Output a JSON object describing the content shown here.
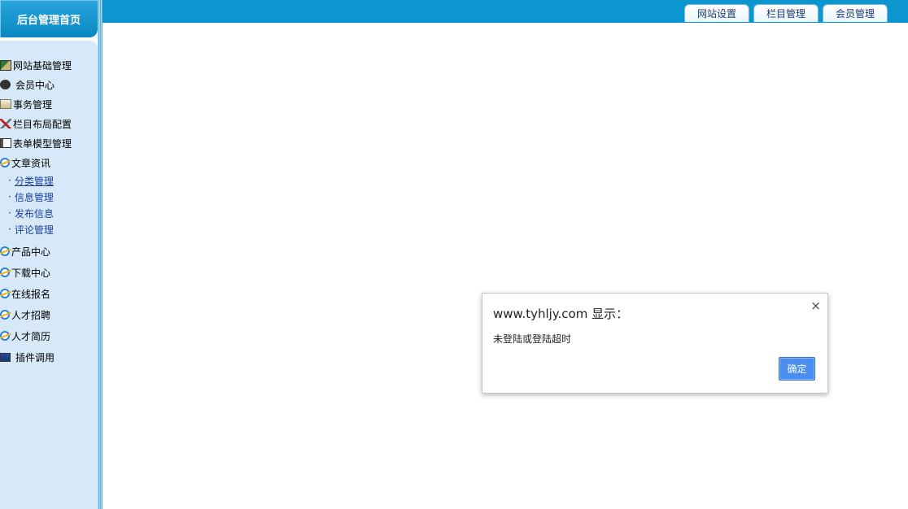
{
  "header": {
    "brand": "后台管理首页",
    "tabs": [
      {
        "label": "网站设置"
      },
      {
        "label": "栏目管理"
      },
      {
        "label": "会员管理"
      }
    ]
  },
  "sidebar": {
    "items": [
      {
        "label": "网站基础管理",
        "icon": "site-admin-icon"
      },
      {
        "label": "会员中心",
        "icon": "member-icon"
      },
      {
        "label": "事务管理",
        "icon": "affairs-icon"
      },
      {
        "label": "栏目布局配置",
        "icon": "tools-icon"
      },
      {
        "label": "表单模型管理",
        "icon": "form-icon"
      },
      {
        "label": "文章资讯",
        "icon": "ie-icon"
      }
    ],
    "subitems": [
      {
        "label": "分类管理"
      },
      {
        "label": "信息管理"
      },
      {
        "label": "发布信息"
      },
      {
        "label": "评论管理"
      }
    ],
    "more_items": [
      {
        "label": "产品中心",
        "icon": "ie-icon"
      },
      {
        "label": "下载中心",
        "icon": "ie-icon"
      },
      {
        "label": "在线报名",
        "icon": "ie-icon"
      },
      {
        "label": "人才招聘",
        "icon": "ie-icon"
      },
      {
        "label": "人才简历",
        "icon": "ie-icon"
      },
      {
        "label": "插件调用",
        "icon": "plugin-icon"
      }
    ]
  },
  "dialog": {
    "title": "www.tyhljy.com 显示：",
    "message": "未登陆或登陆超时",
    "ok_label": "确定",
    "close_symbol": "×"
  },
  "colors": {
    "topbar": "#0b96cf",
    "sidebar": "#d7e9f8",
    "link": "#1a3d9c",
    "ok_button": "#4a8ef0"
  }
}
